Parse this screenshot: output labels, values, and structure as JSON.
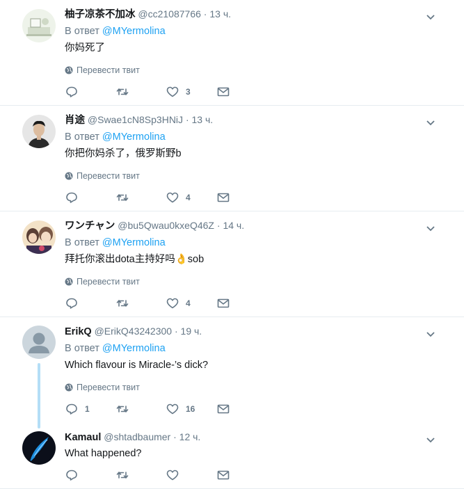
{
  "reply_prefix": "В ответ",
  "translate_label": "Перевести твит",
  "tweets": [
    {
      "name": "柚子凉茶不加冰",
      "handle": "@cc21087766",
      "time": "13 ч.",
      "mention": "@MYermolina",
      "text": "你妈死了",
      "reply_count": "",
      "like_count": "3",
      "avatar_colors": [
        "#eef3ea",
        "#cfd9c6"
      ]
    },
    {
      "name": "肖途",
      "handle": "@Swae1cN8Sp3HNiJ",
      "time": "13 ч.",
      "mention": "@MYermolina",
      "text": "你把你妈杀了，俄罗斯野b",
      "reply_count": "",
      "like_count": "4",
      "avatar_colors": [
        "#e8e8e8",
        "#2a2a2a"
      ]
    },
    {
      "name": "ワンチャン",
      "handle": "@bu5Qwau0kxeQ46Z",
      "time": "14 ч.",
      "mention": "@MYermolina",
      "text": "拜托你滚出dota主持好吗👌sob",
      "reply_count": "",
      "like_count": "4",
      "avatar_colors": [
        "#f3e2c7",
        "#6b4a3c"
      ]
    },
    {
      "name": "ErikQ",
      "handle": "@ErikQ43242300",
      "time": "19 ч.",
      "mention": "@MYermolina",
      "text": "Which flavour is Miracle-’s dick?",
      "reply_count": "1",
      "like_count": "16",
      "avatar_colors": [
        "#ccd6dd",
        "#8899a6"
      ]
    },
    {
      "name": "Kamaul",
      "handle": "@shtadbaumer",
      "time": "12 ч.",
      "text": "What happened?",
      "reply_count": "",
      "like_count": "",
      "avatar_colors": [
        "#0b0f1a",
        "#1d8fe0"
      ]
    }
  ],
  "colors": {
    "link": "#1da1f2",
    "muted": "#657786",
    "thread_line": "#b4def6"
  }
}
